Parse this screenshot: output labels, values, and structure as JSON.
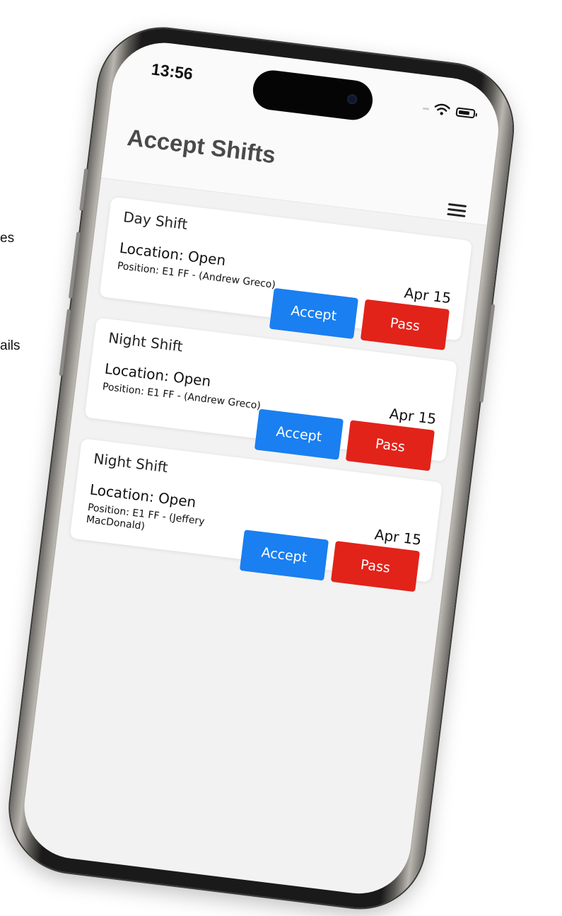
{
  "edge_text": [
    "es",
    "ails"
  ],
  "statusbar": {
    "time": "13:56"
  },
  "header": {
    "title": "Accept Shifts"
  },
  "icons": [
    "signal-icon",
    "wifi-icon",
    "battery-icon",
    "menu-icon"
  ],
  "colors": {
    "accept": "#1a7ff0",
    "pass": "#e2231a",
    "title": "#4a4a4a"
  },
  "shifts": [
    {
      "title": "Day Shift",
      "location": "Location: Open",
      "position": "Position: E1 FF - (Andrew Greco)",
      "date": "Apr 15",
      "accept_label": "Accept",
      "pass_label": "Pass"
    },
    {
      "title": "Night Shift",
      "location": "Location: Open",
      "position": "Position: E1 FF - (Andrew Greco)",
      "date": "Apr 15",
      "accept_label": "Accept",
      "pass_label": "Pass"
    },
    {
      "title": "Night Shift",
      "location": "Location: Open",
      "position": "Position: E1 FF - (Jeffery MacDonald)",
      "date": "Apr 15",
      "accept_label": "Accept",
      "pass_label": "Pass"
    }
  ]
}
